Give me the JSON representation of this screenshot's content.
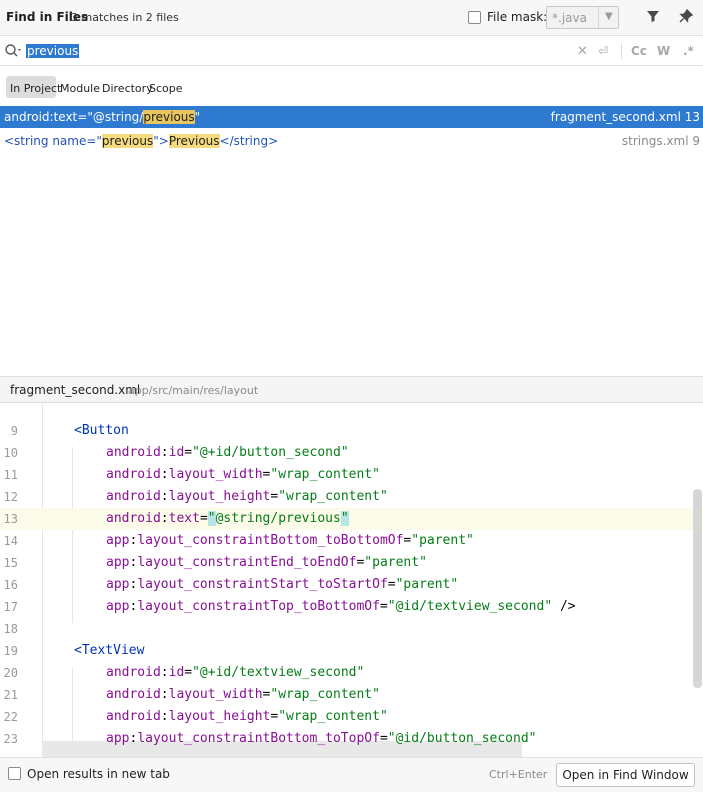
{
  "header": {
    "title": "Find in Files",
    "matches": "3 matches in 2 files",
    "file_mask_label": "File mask:",
    "file_mask_value": "*.java",
    "filter_icon": "filter-icon",
    "pin_icon": "pin-icon"
  },
  "search": {
    "query": "previous",
    "icon": "search-icon",
    "tool_cc": "Cc",
    "tool_w": "W",
    "tool_regex": ".*"
  },
  "scope": {
    "tabs": [
      "In Project",
      "Module",
      "Directory",
      "Scope"
    ],
    "active": "In Project"
  },
  "results": [
    {
      "prefix": "android:text=\"@string/",
      "match": "previous",
      "suffix": "\"",
      "file": "fragment_second.xml 13",
      "selected": true
    },
    {
      "p1": "<string name=\"",
      "m1": "previous",
      "p2": "\">",
      "m2": "Previous",
      "p3": "</string>",
      "file": "strings.xml 9",
      "selected": false
    }
  ],
  "preview": {
    "file": "fragment_second.xml",
    "path": "app/src/main/res/layout"
  },
  "editor": {
    "current_line": 13,
    "lines": [
      {
        "n": "9",
        "t": "<Button"
      },
      {
        "n": "10",
        "t": "android:id=\"@+id/button_second\""
      },
      {
        "n": "11",
        "t": "android:layout_width=\"wrap_content\""
      },
      {
        "n": "12",
        "t": "android:layout_height=\"wrap_content\""
      },
      {
        "n": "13",
        "t": "android:text=\"@string/previous\""
      },
      {
        "n": "14",
        "t": "app:layout_constraintBottom_toBottomOf=\"parent\""
      },
      {
        "n": "15",
        "t": "app:layout_constraintEnd_toEndOf=\"parent\""
      },
      {
        "n": "16",
        "t": "app:layout_constraintStart_toStartOf=\"parent\""
      },
      {
        "n": "17",
        "t": "app:layout_constraintTop_toBottomOf=\"@id/textview_second\" />"
      },
      {
        "n": "18",
        "t": ""
      },
      {
        "n": "19",
        "t": "<TextView"
      },
      {
        "n": "20",
        "t": "android:id=\"@+id/textview_second\""
      },
      {
        "n": "21",
        "t": "android:layout_width=\"wrap_content\""
      },
      {
        "n": "22",
        "t": "android:layout_height=\"wrap_content\""
      },
      {
        "n": "23",
        "t": "app:layout_constraintBottom_toTopOf=\"@id/button_second\""
      }
    ]
  },
  "footer": {
    "open_in_new_tab": "Open results in new tab",
    "shortcut": "Ctrl+Enter",
    "open_button": "Open in Find Window"
  },
  "colors": {
    "selection": "#2f7ad1",
    "match_highlight": "#e9c55e",
    "current_line": "#fcfae8"
  }
}
